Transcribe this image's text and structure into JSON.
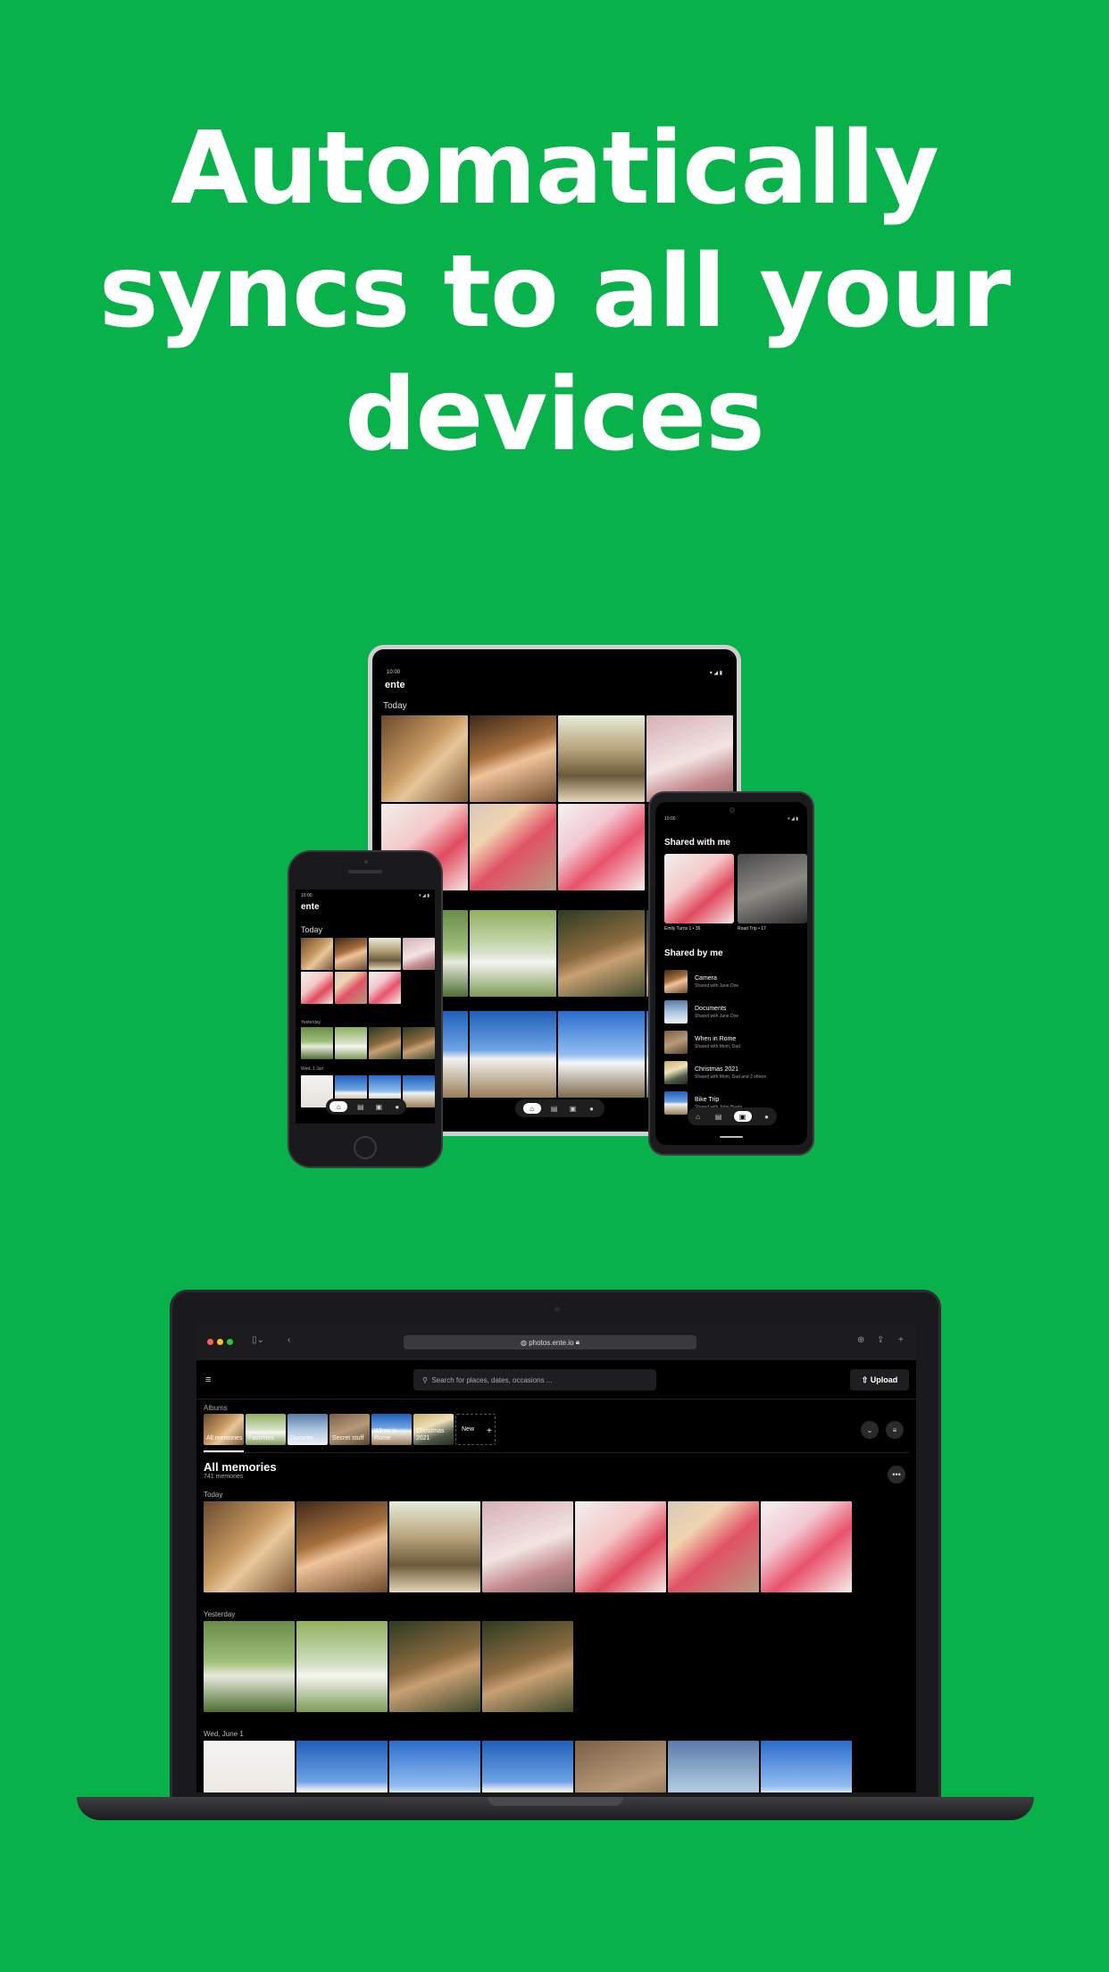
{
  "headline": {
    "line1": "Automatically",
    "line2": "syncs to all your",
    "line3": "devices"
  },
  "tablet": {
    "time": "10:00",
    "app_name": "ente",
    "today_label": "Today"
  },
  "iphone": {
    "time": "10:00",
    "app_name": "ente",
    "today_label": "Today",
    "yesterday_label": "Yesterday",
    "date_label": "Wed, 1 Jun"
  },
  "android": {
    "time": "10:00",
    "shared_with_me_title": "Shared with me",
    "shared_cards": [
      {
        "name": "Emily Turns 1",
        "count": "36"
      },
      {
        "name": "Road Trip",
        "count": "17"
      }
    ],
    "shared_by_me_title": "Shared by me",
    "shared_by_me": [
      {
        "title": "Camera",
        "subtitle": "Shared with Jane Doe"
      },
      {
        "title": "Documents",
        "subtitle": "Shared with Jane Doe"
      },
      {
        "title": "When in Rome",
        "subtitle": "Shared with Mom, Dad"
      },
      {
        "title": "Christmas 2021",
        "subtitle": "Shared with Mom, Dad and 2 others"
      },
      {
        "title": "Bike Trip",
        "subtitle": "Shared with John Brady"
      }
    ]
  },
  "laptop": {
    "url": "photos.ente.io",
    "search_placeholder": "Search for places, dates, occasions ...",
    "upload_label": "Upload",
    "albums_label": "Albums",
    "albums": [
      "All memories",
      "Favorites",
      "Docume...",
      "Secret stuff",
      "When in Rome",
      "Christmas 2021",
      "New"
    ],
    "section_title": "All memories",
    "memory_count": "741 memories",
    "today_label": "Today",
    "yesterday_label": "Yesterday",
    "date_label": "Wed, June 1"
  },
  "colors": {
    "background": "#08B14A",
    "screen": "#000000",
    "text": "#FFFFFF"
  }
}
